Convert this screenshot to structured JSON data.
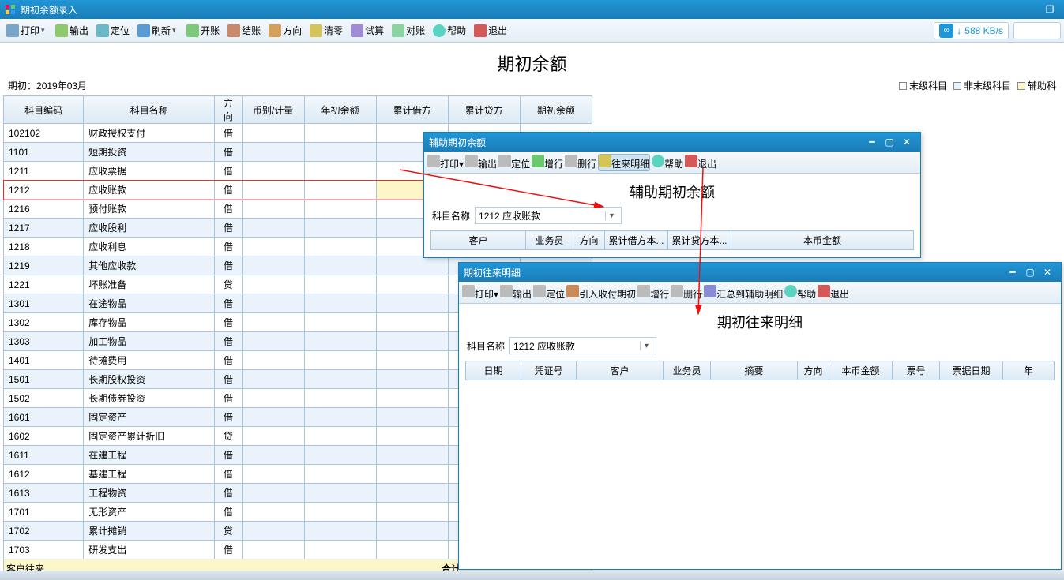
{
  "window": {
    "title": "期初余额录入"
  },
  "main_toolbar": {
    "print": "打印",
    "export": "输出",
    "locate": "定位",
    "refresh": "刷新",
    "open": "开账",
    "close": "结账",
    "direction": "方向",
    "clear": "清零",
    "calc": "试算",
    "check": "对账",
    "help": "帮助",
    "exit": "退出"
  },
  "speed": {
    "value": "588 KB/s"
  },
  "page_title": "期初余额",
  "period_label": "期初：",
  "period_value": "2019年03月",
  "legend": {
    "leaf": "末级科目",
    "nonleaf": "非末级科目",
    "aux": "辅助科"
  },
  "columns": {
    "code": "科目编码",
    "name": "科目名称",
    "dir": "方向",
    "curr": "币别/计量",
    "ybal": "年初余额",
    "debit": "累计借方",
    "credit": "累计贷方",
    "obal": "期初余额"
  },
  "rows": [
    {
      "code": "102102",
      "name": "财政授权支付",
      "dir": "借"
    },
    {
      "code": "1101",
      "name": "短期投资",
      "dir": "借"
    },
    {
      "code": "1211",
      "name": "应收票据",
      "dir": "借"
    },
    {
      "code": "1212",
      "name": "应收账款",
      "dir": "借",
      "sel": true
    },
    {
      "code": "1216",
      "name": "预付账款",
      "dir": "借"
    },
    {
      "code": "1217",
      "name": "应收股利",
      "dir": "借"
    },
    {
      "code": "1218",
      "name": "应收利息",
      "dir": "借"
    },
    {
      "code": "1219",
      "name": "其他应收款",
      "dir": "借"
    },
    {
      "code": "1221",
      "name": "坏账准备",
      "dir": "贷"
    },
    {
      "code": "1301",
      "name": "在途物品",
      "dir": "借"
    },
    {
      "code": "1302",
      "name": "库存物品",
      "dir": "借"
    },
    {
      "code": "1303",
      "name": "加工物品",
      "dir": "借"
    },
    {
      "code": "1401",
      "name": "待摊费用",
      "dir": "借"
    },
    {
      "code": "1501",
      "name": "长期股权投资",
      "dir": "借"
    },
    {
      "code": "1502",
      "name": "长期债券投资",
      "dir": "借"
    },
    {
      "code": "1601",
      "name": "固定资产",
      "dir": "借"
    },
    {
      "code": "1602",
      "name": "固定资产累计折旧",
      "dir": "贷"
    },
    {
      "code": "1611",
      "name": "在建工程",
      "dir": "借"
    },
    {
      "code": "1612",
      "name": "基建工程",
      "dir": "借"
    },
    {
      "code": "1613",
      "name": "工程物资",
      "dir": "借"
    },
    {
      "code": "1701",
      "name": "无形资产",
      "dir": "借"
    },
    {
      "code": "1702",
      "name": "累计摊销",
      "dir": "贷"
    },
    {
      "code": "1703",
      "name": "研发支出",
      "dir": "借"
    }
  ],
  "sum_label": "合计:",
  "footer_text": "客户往来",
  "aux_window": {
    "title": "辅助期初余额",
    "toolbar": {
      "print": "打印",
      "export": "输出",
      "locate": "定位",
      "addrow": "增行",
      "delrow": "删行",
      "detail": "往来明细",
      "help": "帮助",
      "exit": "退出"
    },
    "content_title": "辅助期初余额",
    "field_label": "科目名称",
    "field_value": "1212 应收账款",
    "columns": {
      "cust": "客户",
      "sales": "业务员",
      "dir": "方向",
      "debit": "累计借方本...",
      "credit": "累计贷方本...",
      "amt": "本币金额"
    }
  },
  "detail_window": {
    "title": "期初往来明细",
    "toolbar": {
      "print": "打印",
      "export": "输出",
      "locate": "定位",
      "import": "引入收付期初",
      "addrow": "增行",
      "delrow": "删行",
      "sum": "汇总到辅助明细",
      "help": "帮助",
      "exit": "退出"
    },
    "content_title": "期初往来明细",
    "field_label": "科目名称",
    "field_value": "1212 应收账款",
    "columns": {
      "date": "日期",
      "voucher": "凭证号",
      "cust": "客户",
      "sales": "业务员",
      "digest": "摘要",
      "dir": "方向",
      "amt": "本币金额",
      "billno": "票号",
      "billdate": "票据日期",
      "year": "年"
    }
  }
}
